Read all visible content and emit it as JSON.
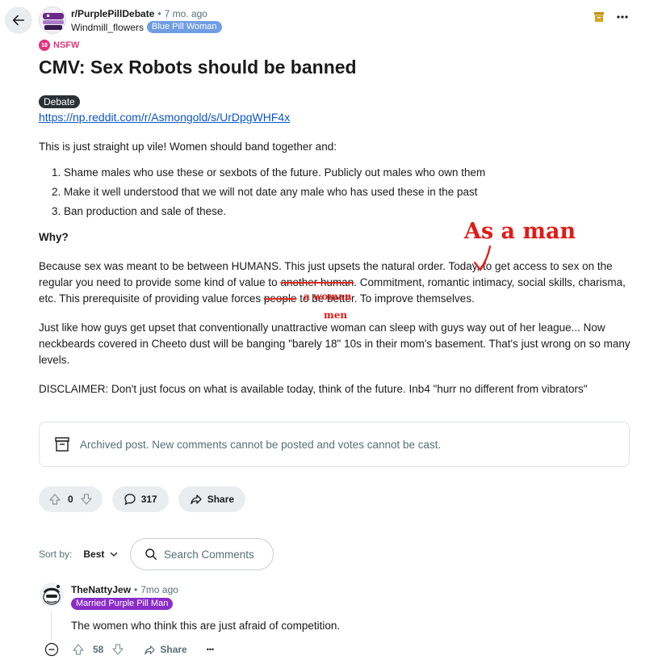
{
  "header": {
    "subreddit": "r/PurplePillDebate",
    "separator": "•",
    "time_ago": "7 mo. ago",
    "author": "Windmill_flowers",
    "author_flair": "Blue Pill Woman",
    "author_flair_color": "#6f9ee6"
  },
  "nsfw": {
    "badge": "18",
    "label": "NSFW",
    "color": "#d93a79"
  },
  "post": {
    "title": "CMV: Sex Robots should be banned",
    "flair": "Debate",
    "link": "https://np.reddit.com/r/Asmongold/s/UrDpgWHF4x",
    "intro": "This is just straight up vile! Women should band together and:",
    "list": [
      "Shame males who use these or sexbots of the future. Publicly out males who own them",
      "Make it well understood that we will not date any male who has used these in the past",
      "Ban production and sale of these."
    ],
    "why": "Why?",
    "para1_a": "Because sex was meant to be between HUMANS. This just upsets the natural order. Today, to get access to sex on the regular you need to provide some kind of value to ",
    "para1_strike1": "another human",
    "para1_b": ". Commitment, romantic intimacy, social skills, charisma, etc. This prerequisite of providing value forces ",
    "para1_strike2": "people",
    "para1_c": " to be better. To improve themselves.",
    "para2": "Just like how guys get upset that conventionally unattractive woman can sleep with guys way out of her league... Now neckbeards covered in Cheeto dust will be banging \"barely 18\" 10s in their mom's basement. That's just wrong on so many levels.",
    "para3": "DISCLAIMER: Don't just focus on what is available today, think of the future. Inb4 \"hurr no different from vibrators\""
  },
  "annotations": {
    "as_a_man": "As a man",
    "a_woman": "a woman",
    "men": "men",
    "color": "#e01b16"
  },
  "archived_notice": "Archived post. New comments cannot be posted and votes cannot be cast.",
  "actions": {
    "votes": "0",
    "comments": "317",
    "share": "Share"
  },
  "sort": {
    "label": "Sort by:",
    "value": "Best",
    "search_placeholder": "Search Comments"
  },
  "comment": {
    "author": "TheNattyJew",
    "separator": "•",
    "time_ago": "7mo ago",
    "flair": "Married Purple Pill Man",
    "flair_color": "#8a2cc9",
    "text": "The women who think this are just afraid of competition.",
    "votes": "58",
    "share": "Share",
    "more": "•••"
  }
}
